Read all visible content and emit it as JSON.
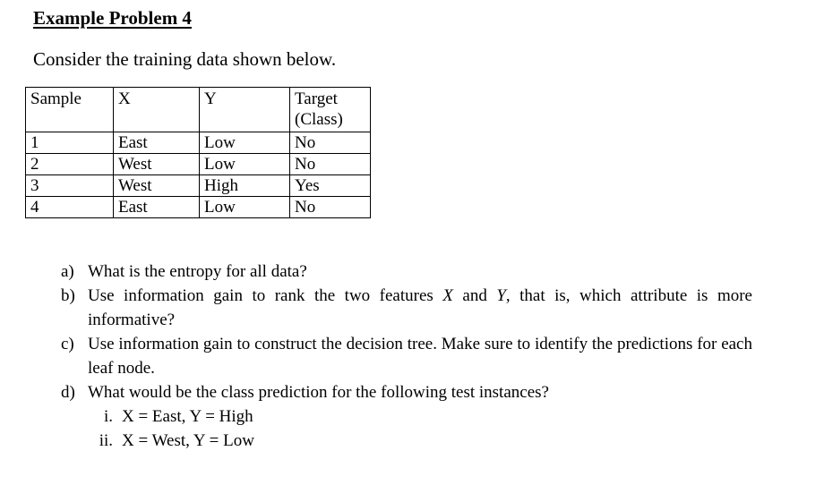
{
  "title": "Example Problem 4",
  "intro": "Consider the training data shown below.",
  "table": {
    "headers": [
      "Sample",
      "X",
      "Y",
      "Target (Class)"
    ],
    "header_line1": "Target",
    "header_line2": "(Class)",
    "rows": [
      [
        "1",
        "East",
        "Low",
        "No"
      ],
      [
        "2",
        "West",
        "Low",
        "No"
      ],
      [
        "3",
        "West",
        "High",
        "Yes"
      ],
      [
        "4",
        "East",
        "Low",
        "No"
      ]
    ]
  },
  "questions": [
    {
      "label": "a)",
      "text": "What is the entropy for all data?"
    },
    {
      "label": "b)",
      "text_pre": "Use information gain to rank the two features ",
      "var1": "X",
      "mid": " and ",
      "var2": "Y",
      "text_post": ", that is, which attribute is more informative?"
    },
    {
      "label": "c)",
      "text": "Use information gain to construct the decision tree. Make sure to identify the predictions for each leaf node."
    },
    {
      "label": "d)",
      "text": "What would be the class prediction for the following test instances?"
    }
  ],
  "test_instances": [
    {
      "label": "i.",
      "text": "X = East, Y = High"
    },
    {
      "label": "ii.",
      "text": "X = West, Y = Low"
    }
  ]
}
